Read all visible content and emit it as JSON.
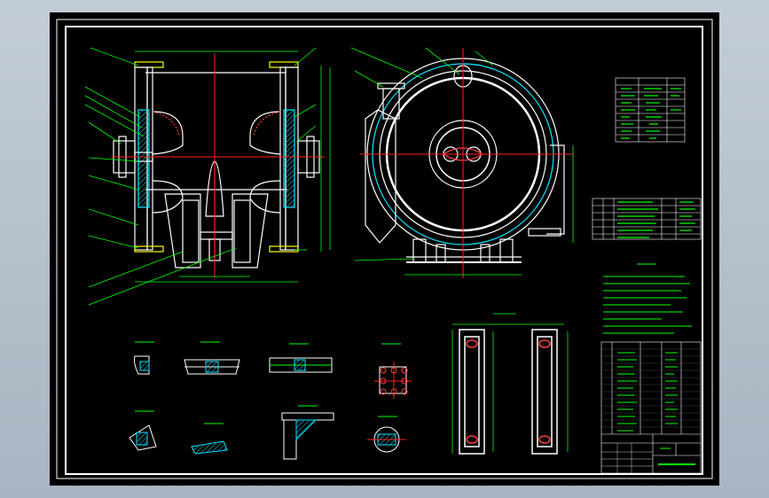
{
  "drawing": {
    "sheet_color": "#000000",
    "border_color": "#ffffff",
    "leader_color": "#00ff00",
    "dimension_color": "#00ff00",
    "centerline_color": "#ff2020",
    "hatch_color": "#00e5ff",
    "accent_color": "#ffff00"
  }
}
